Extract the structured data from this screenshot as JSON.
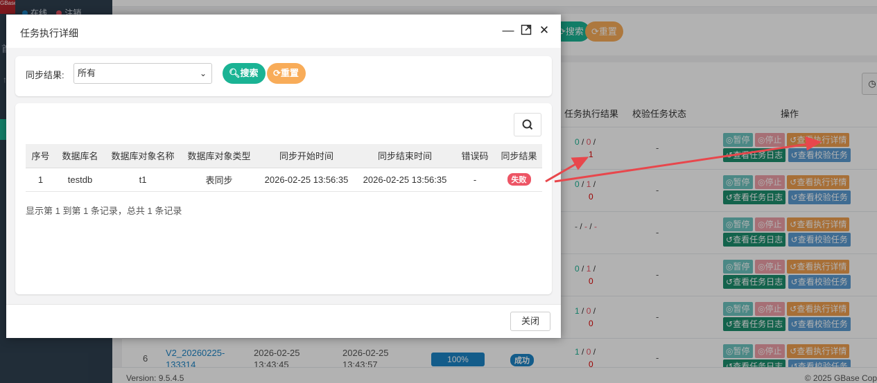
{
  "sidebar": {
    "logo_text": "GBase",
    "status_online": "在线",
    "status_logout": "注销",
    "nav_home": "首",
    "nav_other": "↑"
  },
  "background": {
    "search_label": "搜索",
    "reset_label": "重置",
    "columns": [
      "任务执行结果",
      "校验任务状态",
      "操作"
    ],
    "ops": {
      "pause": "暂停",
      "stop": "停止",
      "detail": "查看执行详情",
      "log": "查看任务日志",
      "verify": "查看校验任务"
    },
    "rows": [
      {
        "a": "0",
        "b": "0",
        "c": "1",
        "check": "-"
      },
      {
        "a": "0",
        "b": "1",
        "c": "0",
        "check": "-"
      },
      {
        "a": "-",
        "b": "-",
        "c": "-",
        "check": "-"
      },
      {
        "a": "0",
        "b": "1",
        "c": "0",
        "check": "-"
      },
      {
        "a": "1",
        "b": "0",
        "c": "0",
        "check": "-"
      },
      {
        "a": "1",
        "b": "0",
        "c": "0",
        "check": "-"
      }
    ],
    "row6": {
      "index": "6",
      "name_line1": "V2_20260225-",
      "name_line2": "133314",
      "start_date": "2026-02-25",
      "start_time": "13:43:45",
      "end_date": "2026-02-25",
      "end_time": "13:43:57",
      "progress": "100%",
      "status": "成功"
    },
    "footer_version": "Version: 9.5.4.5",
    "footer_copy": "© 2025 GBase Cop"
  },
  "modal": {
    "title": "任务执行详细",
    "filter_label": "同步结果:",
    "filter_value": "所有",
    "search_label": "搜索",
    "reset_label": "重置",
    "columns": [
      "序号",
      "数据库名",
      "数据库对象名称",
      "数据库对象类型",
      "同步开始时间",
      "同步结束时间",
      "错误码",
      "同步结果"
    ],
    "rows": [
      {
        "index": "1",
        "db": "testdb",
        "object": "t1",
        "type": "表同步",
        "start": "2026-02-25 13:56:35",
        "end": "2026-02-25 13:56:35",
        "error": "-",
        "result": "失败"
      }
    ],
    "summary": "显示第 1 到第 1 条记录，总共 1 条记录",
    "close_label": "关闭"
  },
  "colors": {
    "primary": "#1ab394",
    "warning": "#f8ac59",
    "danger": "#ed5565",
    "info": "#1c84c6",
    "annotation_arrow": "#e8474c"
  }
}
